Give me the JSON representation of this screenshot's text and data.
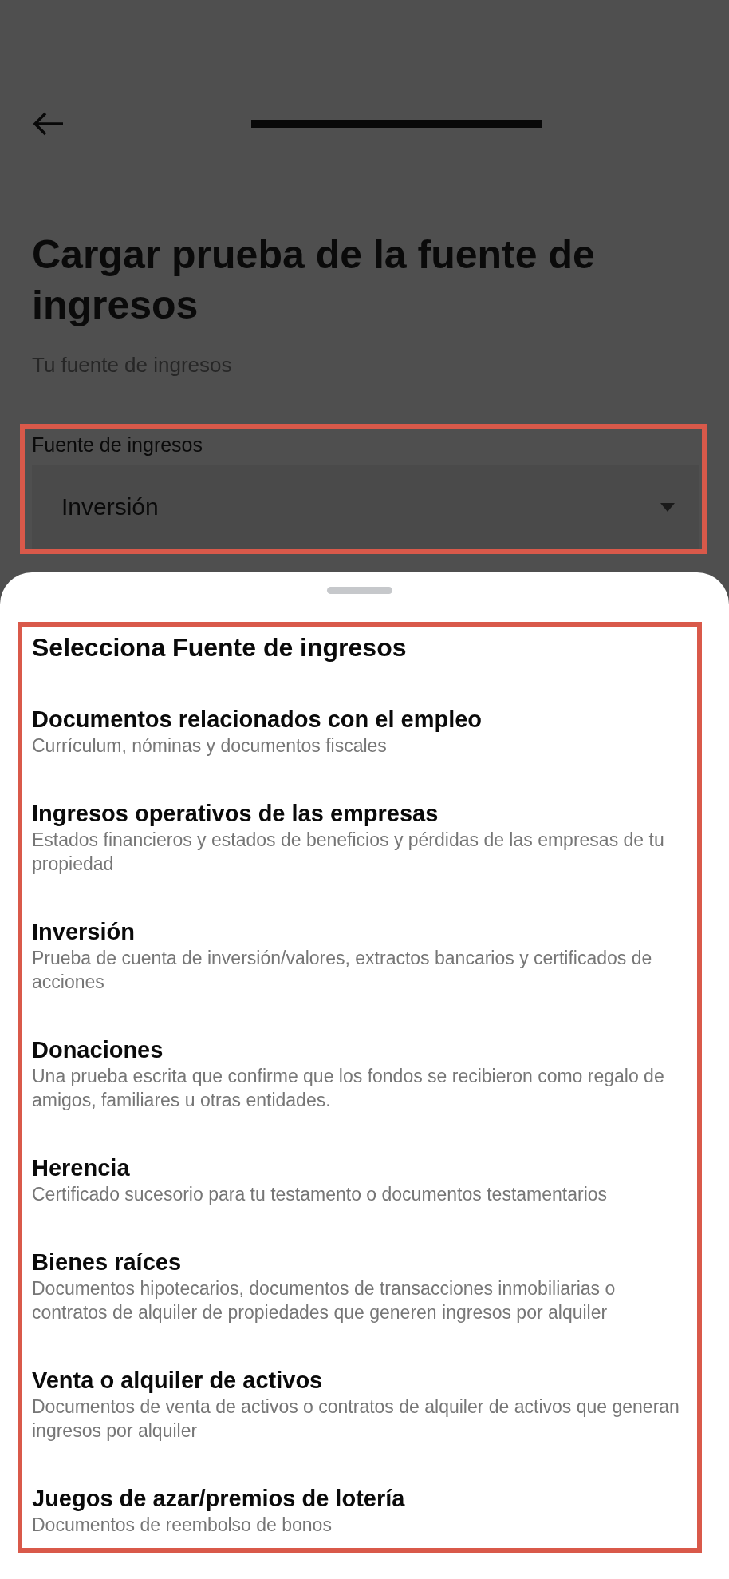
{
  "page": {
    "title": "Cargar prueba de la fuente de ingresos",
    "subtitle": "Tu fuente de ingresos"
  },
  "income_source_field": {
    "label": "Fuente de ingresos",
    "value": "Inversión"
  },
  "sheet": {
    "title": "Selecciona Fuente de ingresos",
    "options": [
      {
        "title": "Documentos relacionados con el empleo",
        "description": "Currículum, nóminas y documentos fiscales"
      },
      {
        "title": "Ingresos operativos de las empresas",
        "description": "Estados financieros y estados de beneficios y pérdidas de las empresas de tu propiedad"
      },
      {
        "title": "Inversión",
        "description": "Prueba de cuenta de inversión/valores, extractos bancarios y certificados de acciones"
      },
      {
        "title": "Donaciones",
        "description": "Una prueba escrita que confirme que los fondos se recibieron como regalo de amigos, familiares u otras entidades."
      },
      {
        "title": "Herencia",
        "description": "Certificado sucesorio para tu testamento o documentos testamentarios"
      },
      {
        "title": "Bienes raíces",
        "description": "Documentos hipotecarios, documentos de transacciones inmobiliarias o contratos de alquiler de propiedades que generen ingresos por alquiler"
      },
      {
        "title": "Venta o alquiler de activos",
        "description": "Documentos de venta de activos o contratos de alquiler de activos que generan ingresos por alquiler"
      },
      {
        "title": "Juegos de azar/premios de lotería",
        "description": "Documentos de reembolso de bonos"
      }
    ]
  }
}
